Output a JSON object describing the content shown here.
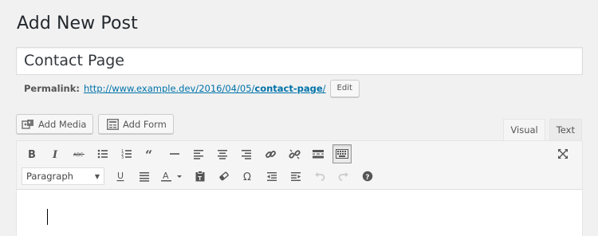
{
  "page": {
    "title": "Add New Post"
  },
  "post": {
    "title": "Contact Page"
  },
  "permalink": {
    "label": "Permalink:",
    "url_base": "http://www.example.dev/2016/04/05/",
    "slug": "contact-page",
    "trailing": "/",
    "edit_label": "Edit"
  },
  "media_buttons": {
    "add_media": "Add Media",
    "add_form": "Add Form"
  },
  "tabs": {
    "visual": "Visual",
    "text": "Text",
    "active": "visual"
  },
  "toolbar": {
    "row1": [
      "bold-icon",
      "italic-icon",
      "strikethrough-icon",
      "bulleted-list-icon",
      "numbered-list-icon",
      "blockquote-icon",
      "horizontal-line-icon",
      "align-left-icon",
      "align-center-icon",
      "align-right-icon",
      "link-icon",
      "unlink-icon",
      "read-more-icon",
      "toolbar-toggle-icon"
    ],
    "row2": [
      "underline-icon",
      "justify-icon",
      "text-color-icon",
      "paste-as-text-icon",
      "clear-formatting-icon",
      "special-character-icon",
      "outdent-icon",
      "indent-icon",
      "undo-icon",
      "redo-icon",
      "help-icon"
    ],
    "format_select": "Paragraph",
    "expand": "fullscreen-icon"
  },
  "colors": {
    "accent": "#0073aa",
    "bg": "#f1f1f1"
  }
}
